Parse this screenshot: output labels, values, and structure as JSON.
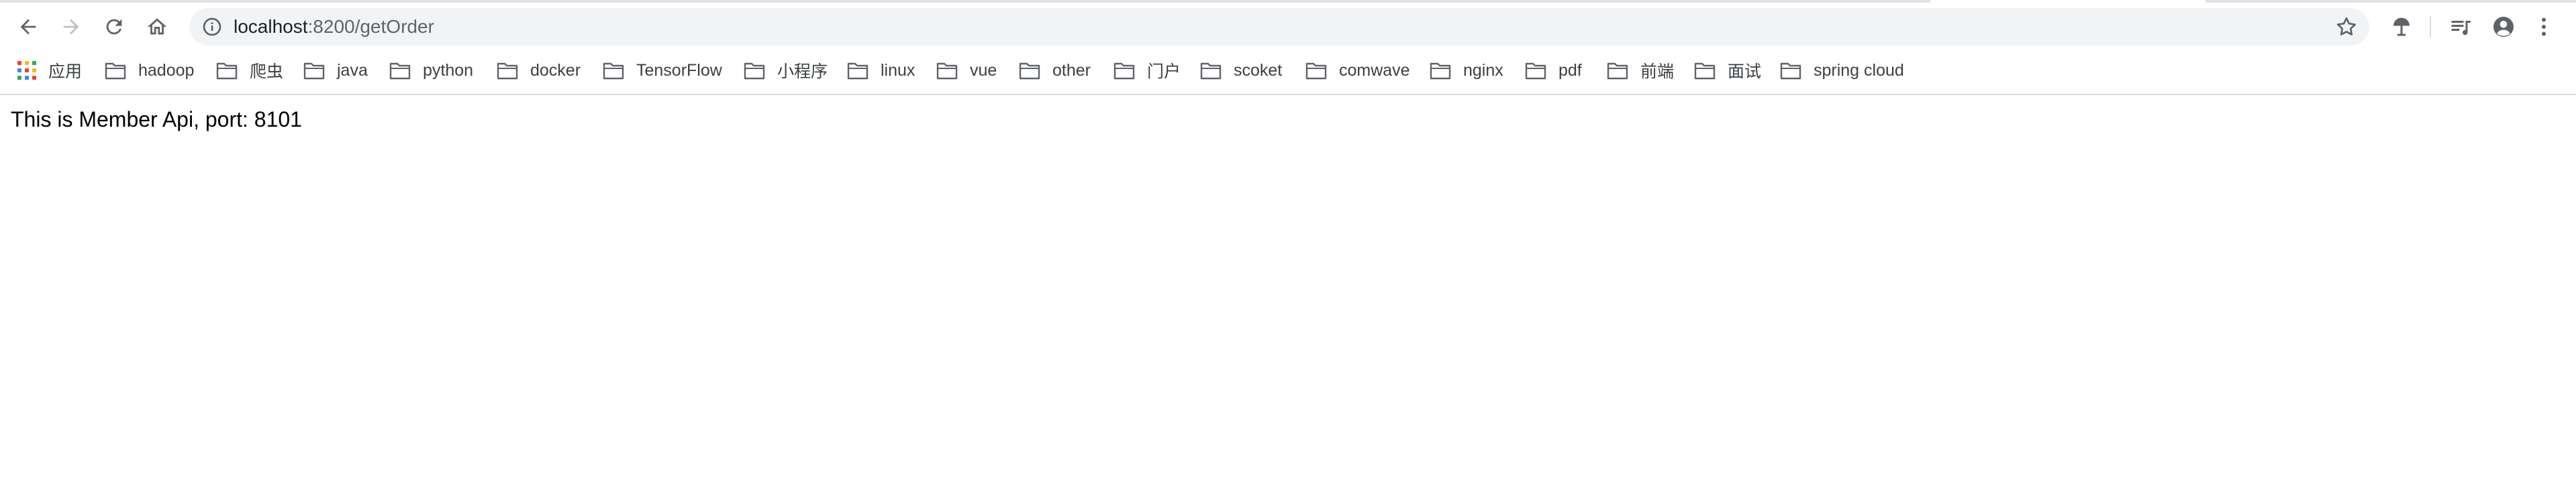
{
  "toolbar": {
    "url_host": "localhost",
    "url_path": ":8200/getOrder"
  },
  "bookmarks": {
    "apps_label": "应用",
    "folders": [
      "hadoop",
      "爬虫",
      "java",
      "python",
      "docker",
      "TensorFlow",
      "小程序",
      "linux",
      "vue",
      "other",
      "门户",
      "scoket",
      "comwave",
      "nginx",
      "pdf",
      "前端",
      "面试",
      "spring cloud"
    ]
  },
  "page": {
    "body_text": "This is Member Api, port: 8101"
  },
  "colors": {
    "icon": "#5f6368",
    "omnibox_bg": "#f1f3f4",
    "text": "#3c4043"
  }
}
